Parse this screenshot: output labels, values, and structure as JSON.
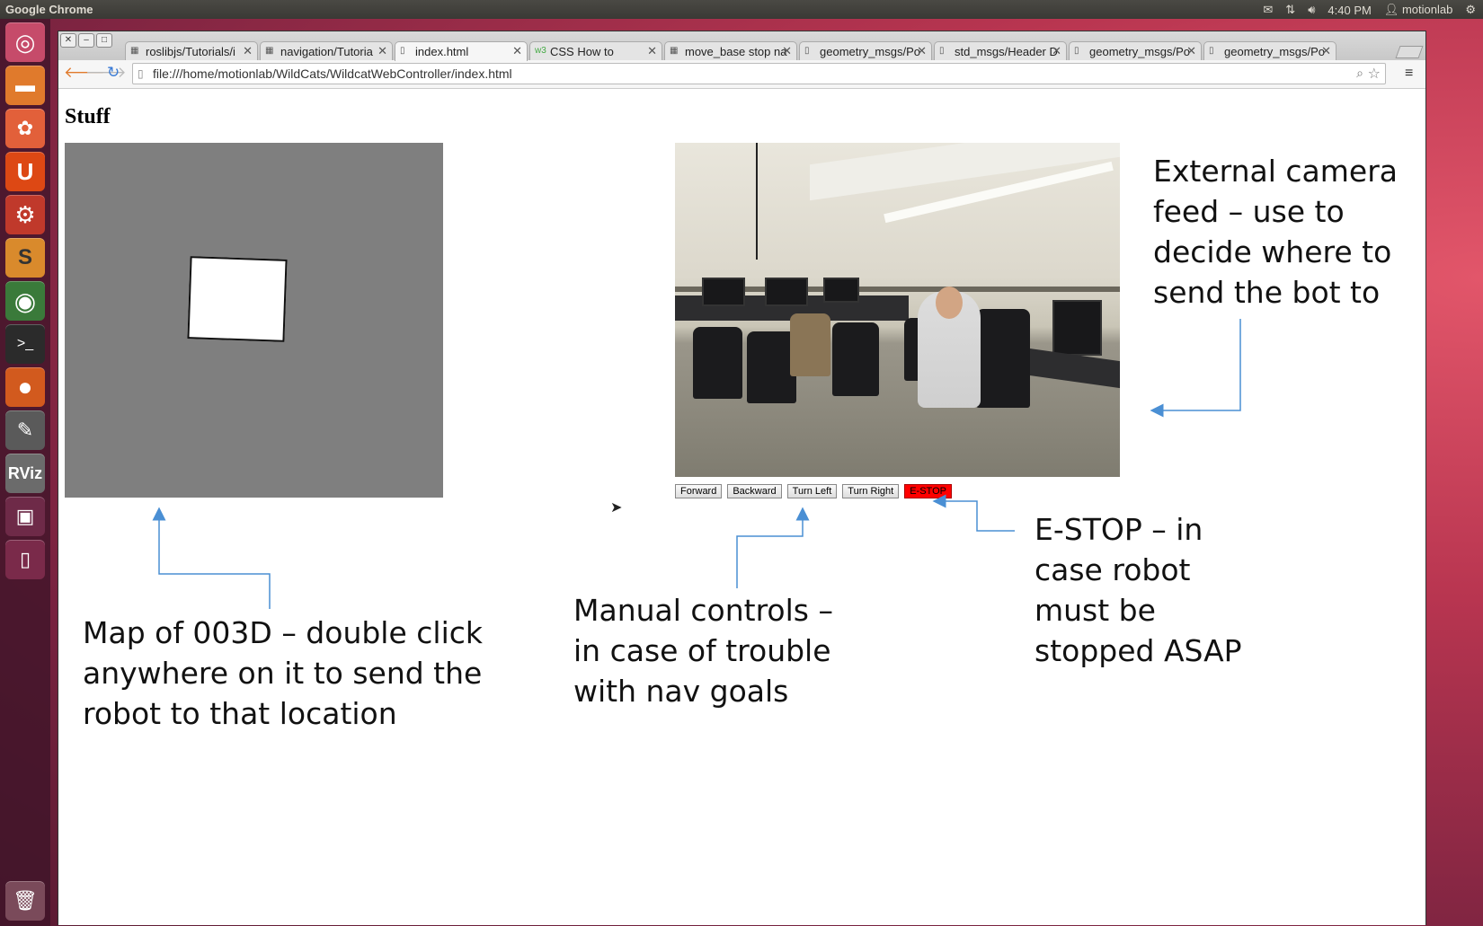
{
  "panel": {
    "app_title": "Google Chrome",
    "time": "4:40 PM",
    "user": "motionlab"
  },
  "browser": {
    "tabs": [
      {
        "label": "roslibjs/Tutorials/i"
      },
      {
        "label": "navigation/Tutoria"
      },
      {
        "label": "index.html"
      },
      {
        "label": "CSS How to"
      },
      {
        "label": "move_base stop na"
      },
      {
        "label": "geometry_msgs/Po"
      },
      {
        "label": "std_msgs/Header D"
      },
      {
        "label": "geometry_msgs/Po"
      },
      {
        "label": "geometry_msgs/Po"
      }
    ],
    "active_tab_index": 2,
    "url": "file:///home/motionlab/WildCats/WildcatWebController/index.html"
  },
  "page": {
    "heading": "Stuff",
    "controls": {
      "forward": "Forward",
      "backward": "Backward",
      "turn_left": "Turn Left",
      "turn_right": "Turn Right",
      "estop": "E-STOP"
    },
    "annotations": {
      "camera": "External camera\nfeed – use to\ndecide where to\nsend the bot to",
      "map": "Map of 003D – double click\nanywhere on it to send the\nrobot to that location",
      "manual": "Manual controls –\nin case of trouble\nwith nav goals",
      "estop": "E-STOP – in\ncase robot\nmust be\nstopped ASAP"
    }
  },
  "colors": {
    "annotation_arrow": "#4a8fd4",
    "estop": "#ff0000",
    "map_unknown": "#7f7f7f"
  }
}
